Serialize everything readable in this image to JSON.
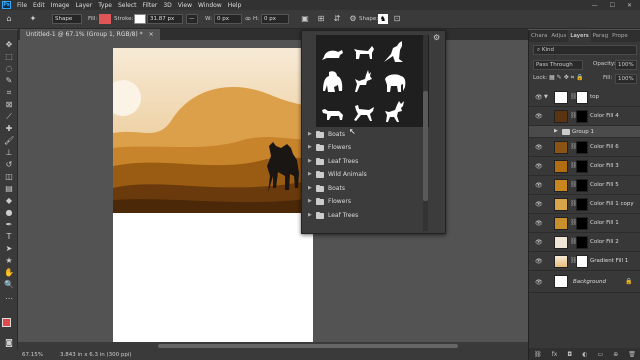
{
  "app": {
    "logo": "Ps"
  },
  "menu": [
    "File",
    "Edit",
    "Image",
    "Layer",
    "Type",
    "Select",
    "Filter",
    "3D",
    "View",
    "Window",
    "Help"
  ],
  "window_controls": [
    "—",
    "☐",
    "✕"
  ],
  "options": {
    "mode": "Shape",
    "fill_label": "Fill:",
    "stroke_label": "Stroke:",
    "stroke_width": "31.87 px",
    "w_label": "W:",
    "w_value": "0 px",
    "h_label": "H:",
    "h_value": "0 px",
    "shape_label": "Shape:",
    "fill_color": "#e05555"
  },
  "document": {
    "tab_title": "Untitled-1 @ 67.1% (Group 1, RGB/8) *",
    "close": "×"
  },
  "status": {
    "zoom": "67.15%",
    "size": "3.843 in x 6.3 in (300 ppi)"
  },
  "picker": {
    "gear": "⚙",
    "shapes": [
      "rat",
      "dog",
      "kangaroo",
      "gorilla",
      "deer",
      "elephant",
      "wolf",
      "gazelle",
      "reindeer"
    ],
    "folders": [
      "Boats",
      "Flowers",
      "Leaf Trees",
      "Wild Animals",
      "Boats",
      "Flowers",
      "Leaf Trees"
    ]
  },
  "panel_tabs": [
    "Chara",
    "Adjus",
    "Layers",
    "Parag",
    "Prope"
  ],
  "layers_panel": {
    "filter_kind": "Kind",
    "blend_mode": "Pass Through",
    "opacity_label": "Opacity:",
    "opacity": "100%",
    "lock_label": "Lock:",
    "fill_label": "Fill:",
    "fill": "100%",
    "layers": [
      {
        "name": "top",
        "color": "#ffffff"
      },
      {
        "name": "Color Fill 4",
        "color": "#5a3410"
      },
      {
        "name": "Group 1",
        "color": ""
      },
      {
        "name": "Color Fill 6",
        "color": "#8a5414"
      },
      {
        "name": "Color Fill 3",
        "color": "#b06d12"
      },
      {
        "name": "Color Fill 5",
        "color": "#c8871e"
      },
      {
        "name": "Color Fill 1 copy",
        "color": "#d9a54a"
      },
      {
        "name": "Color Fill 1",
        "color": "#c8902a"
      },
      {
        "name": "Color Fill 2",
        "color": "#f0e6d8"
      },
      {
        "name": "Gradient Fill 1",
        "color": "#e8c89a"
      },
      {
        "name": "Background",
        "color": "#ffffff"
      }
    ]
  },
  "colors": {
    "foreground": "#e04a4a",
    "background": "#ffffff"
  }
}
